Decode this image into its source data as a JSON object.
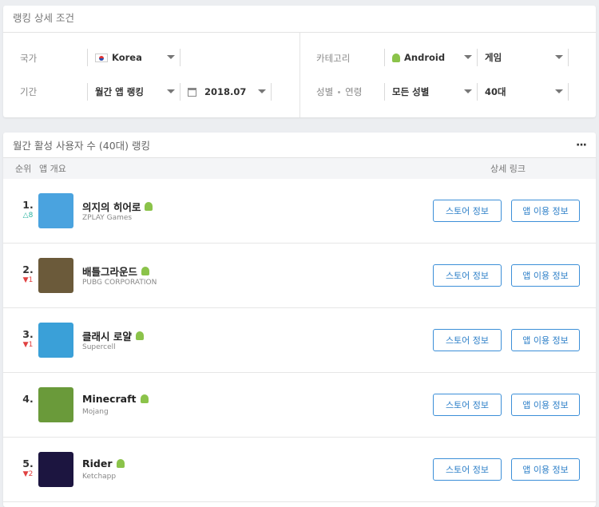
{
  "filters": {
    "title": "랭킹 상세 조건",
    "country_label": "국가",
    "country_value": "Korea",
    "period_label": "기간",
    "period_value": "월간 앱 랭킹",
    "date_value": "2018.07",
    "category_label": "카테고리",
    "platform_value": "Android",
    "category_value": "게임",
    "gender_label": "성별",
    "age_label": "연령",
    "gender_value": "모든 성별",
    "age_value": "40대"
  },
  "ranking": {
    "title": "월간 활성 사용자 수 (40대) 랭킹",
    "more": "···",
    "col_rank": "순위",
    "col_app": "앱 개요",
    "col_link": "상세 링크",
    "store_btn": "스토어 정보",
    "usage_btn": "앱 이용 정보",
    "rows": [
      {
        "rank": "1.",
        "change": "△8",
        "dir": "up",
        "name": "의지의 히어로",
        "developer": "ZPLAY Games",
        "icon": "hero-icon",
        "color": "#4aa3df"
      },
      {
        "rank": "2.",
        "change": "▼1",
        "dir": "down",
        "name": "배틀그라운드",
        "developer": "PUBG CORPORATION",
        "icon": "pubg-icon",
        "color": "#6b5a3a"
      },
      {
        "rank": "3.",
        "change": "▼1",
        "dir": "down",
        "name": "클래시 로얄",
        "developer": "Supercell",
        "icon": "clash-icon",
        "color": "#3aa0d8"
      },
      {
        "rank": "4.",
        "change": "",
        "dir": "none",
        "name": "Minecraft",
        "developer": "Mojang",
        "icon": "minecraft-icon",
        "color": "#6a9a3a"
      },
      {
        "rank": "5.",
        "change": "▼2",
        "dir": "down",
        "name": "Rider",
        "developer": "Ketchapp",
        "icon": "rider-icon",
        "color": "#1c1540"
      }
    ]
  }
}
